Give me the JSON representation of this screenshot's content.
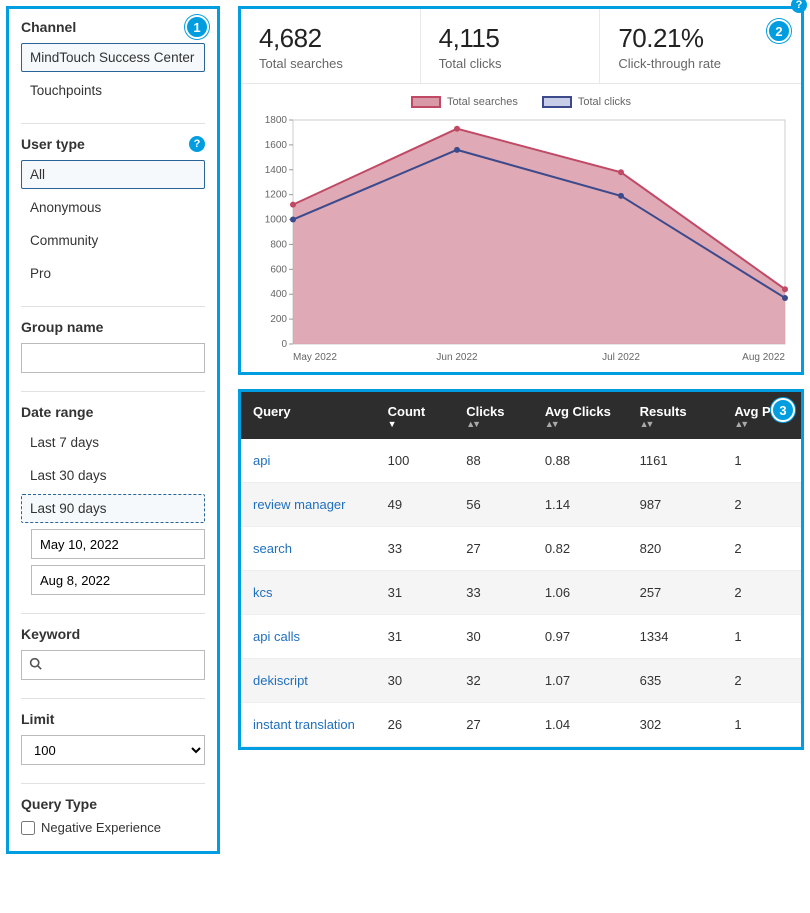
{
  "badges": {
    "one": "1",
    "two": "2",
    "three": "3"
  },
  "help_glyph": "?",
  "sidebar": {
    "channel": {
      "label": "Channel",
      "options": [
        "MindTouch Success Center",
        "Touchpoints"
      ],
      "selected_index": 0
    },
    "user_type": {
      "label": "User type",
      "options": [
        "All",
        "Anonymous",
        "Community",
        "Pro"
      ],
      "selected_index": 0
    },
    "group_name": {
      "label": "Group name",
      "value": ""
    },
    "date_range": {
      "label": "Date range",
      "options": [
        "Last 7 days",
        "Last 30 days",
        "Last 90 days"
      ],
      "selected_index": 2,
      "from": "May 10, 2022",
      "to": "Aug 8, 2022"
    },
    "keyword": {
      "label": "Keyword",
      "value": "",
      "placeholder": ""
    },
    "limit": {
      "label": "Limit",
      "options": [
        "100"
      ],
      "value": "100"
    },
    "query_type": {
      "label": "Query Type",
      "checkbox_label": "Negative Experience",
      "checked": false
    }
  },
  "metrics": {
    "total_searches": {
      "value": "4,682",
      "label": "Total searches"
    },
    "total_clicks": {
      "value": "4,115",
      "label": "Total clicks"
    },
    "ctr": {
      "value": "70.21%",
      "label": "Click-through rate"
    }
  },
  "chart_data": {
    "type": "area",
    "categories": [
      "May 2022",
      "Jun 2022",
      "Jul 2022",
      "Aug 2022"
    ],
    "ylim": [
      0,
      1800
    ],
    "yticks": [
      0,
      200,
      400,
      600,
      800,
      1000,
      1200,
      1400,
      1600,
      1800
    ],
    "series": [
      {
        "name": "Total searches",
        "color_fill": "#d99aa8",
        "color_line": "#c04a65",
        "values": [
          1120,
          1730,
          1380,
          440
        ]
      },
      {
        "name": "Total clicks",
        "color_fill": "none",
        "color_line": "#3c4a8c",
        "values": [
          1000,
          1560,
          1190,
          370
        ]
      }
    ],
    "legend": [
      "Total searches",
      "Total clicks"
    ]
  },
  "table": {
    "columns": [
      "Query",
      "Count",
      "Clicks",
      "Avg Clicks",
      "Results",
      "Avg Pos"
    ],
    "sort_column_index": 1,
    "sort_dir": "desc",
    "rows": [
      {
        "query": "api",
        "count": 100,
        "clicks": 88,
        "avg_clicks": "0.88",
        "results": 1161,
        "avg_pos": 1
      },
      {
        "query": "review manager",
        "count": 49,
        "clicks": 56,
        "avg_clicks": "1.14",
        "results": 987,
        "avg_pos": 2
      },
      {
        "query": "search",
        "count": 33,
        "clicks": 27,
        "avg_clicks": "0.82",
        "results": 820,
        "avg_pos": 2
      },
      {
        "query": "kcs",
        "count": 31,
        "clicks": 33,
        "avg_clicks": "1.06",
        "results": 257,
        "avg_pos": 2
      },
      {
        "query": "api calls",
        "count": 31,
        "clicks": 30,
        "avg_clicks": "0.97",
        "results": 1334,
        "avg_pos": 1
      },
      {
        "query": "dekiscript",
        "count": 30,
        "clicks": 32,
        "avg_clicks": "1.07",
        "results": 635,
        "avg_pos": 2
      },
      {
        "query": "instant translation",
        "count": 26,
        "clicks": 27,
        "avg_clicks": "1.04",
        "results": 302,
        "avg_pos": 1
      }
    ]
  }
}
